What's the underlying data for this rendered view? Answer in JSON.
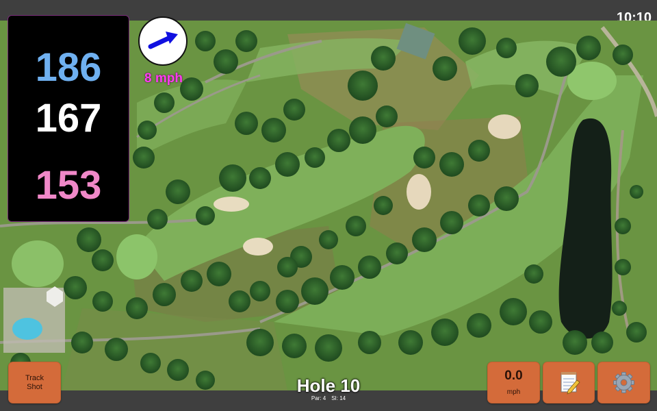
{
  "status": {
    "time": "10:10"
  },
  "distances": {
    "back": "186",
    "middle": "167",
    "front": "153"
  },
  "wind": {
    "speed": "8 mph",
    "arrow_icon": "wind-arrow-icon",
    "arrow_color": "#1010e0"
  },
  "hole": {
    "title": "Hole 10",
    "par": "Par: 4",
    "stroke_index": "SI: 14"
  },
  "buttons": {
    "track_shot_line1": "Track",
    "track_shot_line2": "Shot",
    "speed_value": "0.0",
    "speed_unit": "mph",
    "notes_icon": "notepad-icon",
    "settings_icon": "gear-icon"
  },
  "colors": {
    "button_bg": "#d46b3a",
    "back_distance": "#6fb0f0",
    "middle_distance": "#ffffff",
    "front_distance": "#f088c8",
    "wind_text": "#ff3cf0"
  }
}
